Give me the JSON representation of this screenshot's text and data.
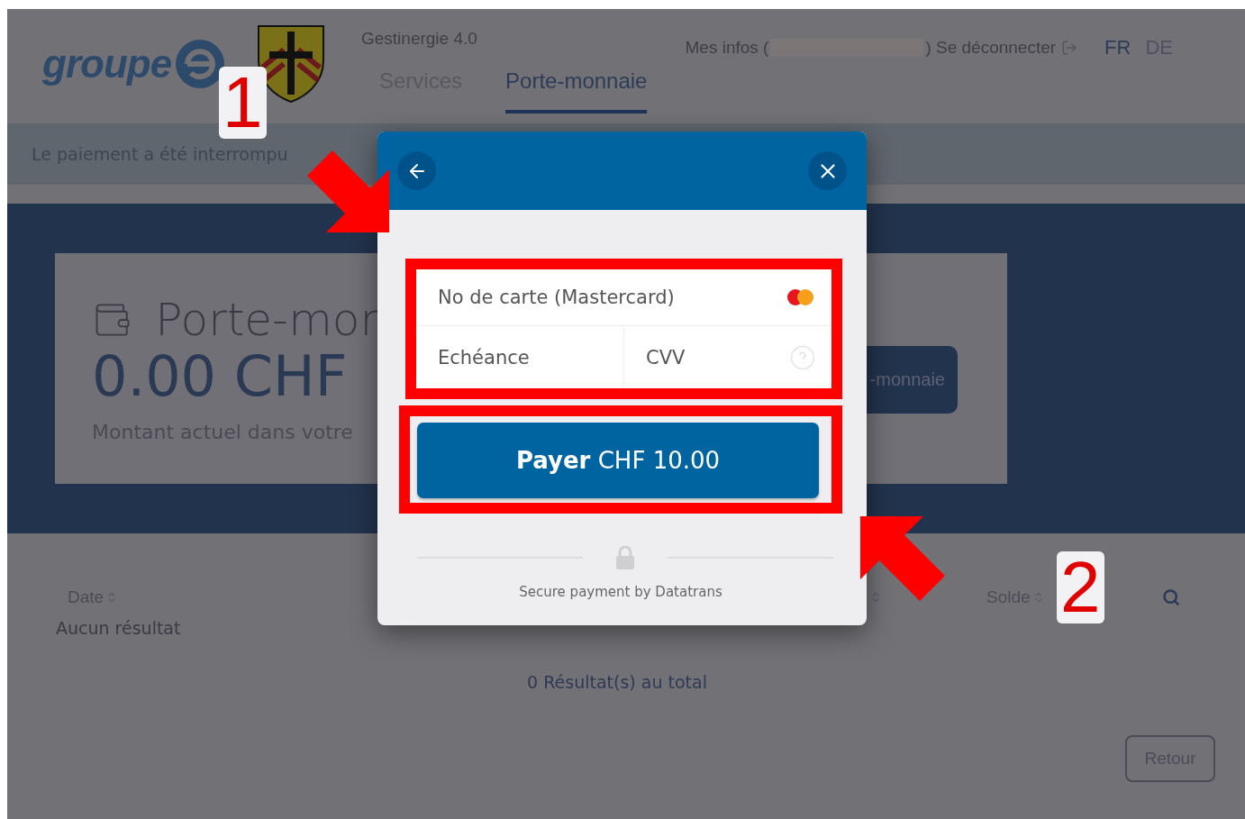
{
  "header": {
    "logo_text": "groupe",
    "app_name": "Gestinergie 4.0",
    "account_prefix": "Mes infos (",
    "logout": ") Se déconnecter",
    "languages": [
      {
        "label": "FR",
        "selected": true
      },
      {
        "label": "DE",
        "selected": false
      }
    ],
    "tabs": [
      {
        "label": "Services",
        "selected": false
      },
      {
        "label": "Porte-monnaie",
        "selected": true
      }
    ]
  },
  "alert": {
    "message": "Le paiement a été interrompu"
  },
  "wallet": {
    "title": "Porte-mor",
    "balance": "0.00 CHF",
    "caption": "Montant actuel dans votre",
    "button": "-monnaie"
  },
  "table": {
    "columns": [
      {
        "label": "Date"
      },
      {
        "label": "Solde"
      }
    ],
    "empty_text": "Aucun résultat",
    "total": "0 Résultat(s) au total"
  },
  "back_button": "Retour",
  "payment_modal": {
    "card_number": {
      "placeholder": "No de carte (Mastercard)"
    },
    "expiry": {
      "placeholder": "Echéance"
    },
    "cvv": {
      "placeholder": "CVV"
    },
    "pay_button": "**Payer** CHF 10.00",
    "footer": "Secure payment by Datatrans"
  },
  "annotations": [
    {
      "label": "1"
    },
    {
      "label": "2"
    }
  ]
}
